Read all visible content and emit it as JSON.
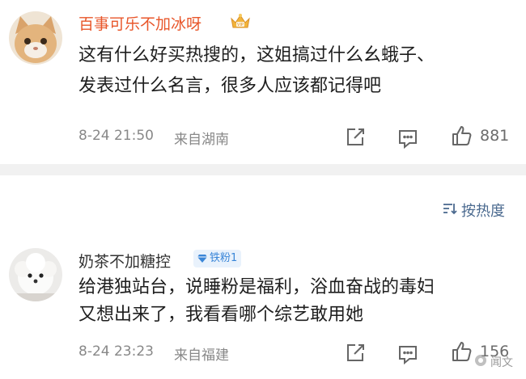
{
  "comments": [
    {
      "username": "百事可乐不加冰呀",
      "text_lines": [
        "这有什么好买热搜的，这姐搞过什么幺蛾子、",
        "发表过什么名言，很多人应该都记得吧"
      ],
      "date": "8-24 21:50",
      "location": "来自湖南",
      "likes": "881"
    },
    {
      "username": "奶茶不加糖控",
      "badge": "铁粉1",
      "text_lines": [
        "给港独站台，说睡粉是福利，浴血奋战的毒妇",
        "又想出来了，我看看哪个综艺敢用她"
      ],
      "date": "8-24 23:23",
      "location": "来自福建",
      "likes": "156"
    }
  ],
  "sort": {
    "label": "按热度"
  },
  "watermark": {
    "text": "闻文"
  },
  "colors": {
    "username_vip": "#e8562a",
    "badge_bg": "#e9f2fc",
    "badge_text": "#3a86d8",
    "sort_text": "#4b6a8f",
    "divider": "#f1f1f1"
  }
}
